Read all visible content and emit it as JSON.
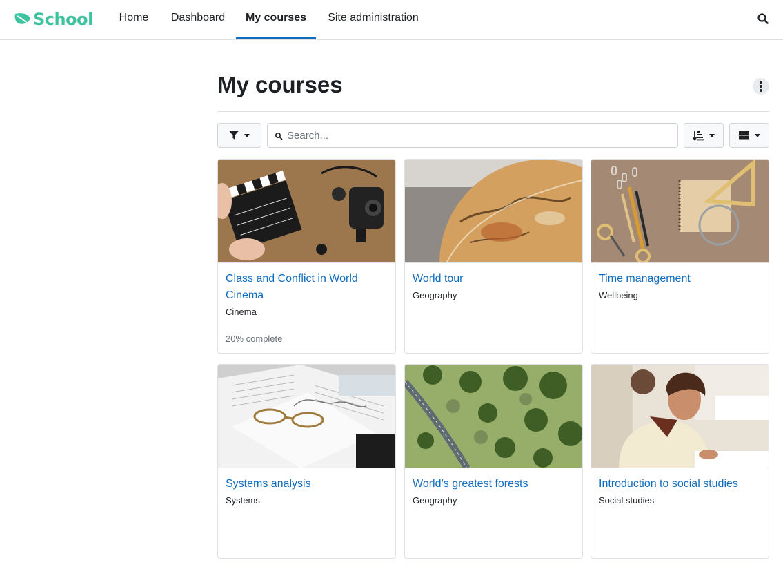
{
  "brand": {
    "name": "School",
    "color": "#3ec3a1",
    "icon": "leaf-icon"
  },
  "nav": {
    "items": [
      {
        "label": "Home",
        "active": false
      },
      {
        "label": "Dashboard",
        "active": false
      },
      {
        "label": "My courses",
        "active": true
      },
      {
        "label": "Site administration",
        "active": false
      }
    ],
    "search_icon": "search-icon"
  },
  "page": {
    "title": "My courses",
    "actions_icon": "kebab-icon"
  },
  "toolbar": {
    "filter_icon": "filter-icon",
    "search_placeholder": "Search...",
    "sort_icon": "sort-icon",
    "view_icon": "grid-view-icon"
  },
  "accent_color": "#0f6cbf",
  "courses": [
    {
      "title": "Class and Conflict in World Cinema",
      "category": "Cinema",
      "progress": "20% complete",
      "image": "clapperboard-camera-image"
    },
    {
      "title": "World tour",
      "category": "Geography",
      "progress": "",
      "image": "globe-image"
    },
    {
      "title": "Time management",
      "category": "Wellbeing",
      "progress": "",
      "image": "stationery-notebook-image"
    },
    {
      "title": "Systems analysis",
      "category": "Systems",
      "progress": "",
      "image": "open-book-glasses-image"
    },
    {
      "title": "World’s greatest forests",
      "category": "Geography",
      "progress": "",
      "image": "aerial-forest-road-image"
    },
    {
      "title": "Introduction to social studies",
      "category": "Social studies",
      "progress": "",
      "image": "student-studying-image"
    }
  ]
}
